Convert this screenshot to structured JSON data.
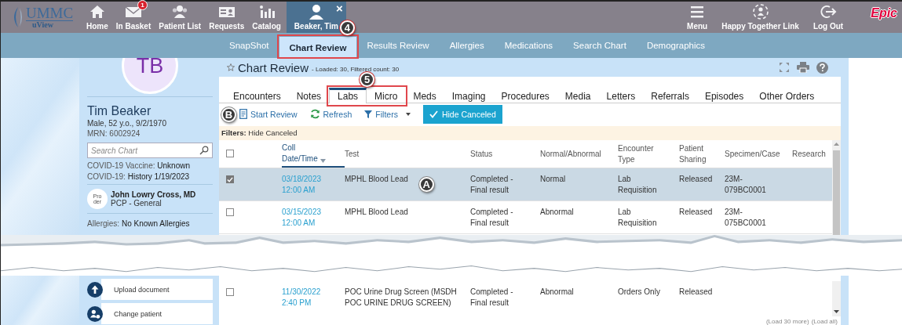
{
  "top_bar": {
    "logo": {
      "name": "UMMC",
      "sub": "uView"
    },
    "items": [
      {
        "label": "Home"
      },
      {
        "label": "In Basket",
        "badge": "1"
      },
      {
        "label": "Patient List"
      },
      {
        "label": "Requests"
      },
      {
        "label": "Catalog"
      }
    ],
    "patient_tab": {
      "label": "Beaker, Tim",
      "close": "×",
      "selected": true
    },
    "right_items": [
      {
        "label": "Menu"
      },
      {
        "label": "Happy Together Link"
      },
      {
        "label": "Log Out"
      }
    ],
    "brand": "Epic"
  },
  "nav_tabs": [
    {
      "label": "SnapShot",
      "selected": false
    },
    {
      "label": "Chart Review",
      "selected": true
    },
    {
      "label": "Results Review",
      "selected": false
    },
    {
      "label": "Allergies",
      "selected": false
    },
    {
      "label": "Medications",
      "selected": false
    },
    {
      "label": "Search Chart",
      "selected": false
    },
    {
      "label": "Demographics",
      "selected": false
    }
  ],
  "patient": {
    "initials": "TB",
    "name": "Tim Beaker",
    "details": "Male, 52 y.o., 9/2/1970",
    "mrn": "MRN: 6002924",
    "search_placeholder": "Search Chart",
    "facts": [
      "COVID-19 Vaccine: **Unknown**",
      "COVID-19: **History 1/19/2023**"
    ],
    "pcp": {
      "photo_alt_lines": [
        "Pro",
        "der"
      ],
      "name": "John Lowry Cross, MD",
      "role": "PCP - General"
    },
    "allergies": "Allergies: **No Known Allergies**",
    "actions": [
      {
        "label": "Upload document"
      },
      {
        "label": "Change patient"
      }
    ]
  },
  "chart_review": {
    "title": "Chart Review",
    "counts": "- Loaded: 30, Filtered count: 30",
    "tabs": [
      {
        "label": "Encounters",
        "selected": false
      },
      {
        "label": "Notes",
        "selected": false
      },
      {
        "label": "Labs",
        "selected": true
      },
      {
        "label": "Micro",
        "selected": false
      },
      {
        "label": "Meds",
        "selected": false
      },
      {
        "label": "Imaging",
        "selected": false
      },
      {
        "label": "Procedures",
        "selected": false
      },
      {
        "label": "Media",
        "selected": false
      },
      {
        "label": "Letters",
        "selected": false
      },
      {
        "label": "Referrals",
        "selected": false
      },
      {
        "label": "Episodes",
        "selected": false
      },
      {
        "label": "Other Orders",
        "selected": false
      }
    ],
    "toolbar": {
      "start_review": "Start Review",
      "refresh": "Refresh",
      "filters": "Filters",
      "hide_canceled": {
        "label": "Hide Canceled",
        "on": true
      }
    },
    "filter_summary": "**Filters:** Hide Canceled",
    "table": {
      "select_all_checked": false,
      "columns": [
        {
          "label": "Coll\nDate/Time",
          "sorted": true
        },
        {
          "label": "Test",
          "sorted": false
        },
        {
          "label": "Status",
          "sorted": false
        },
        {
          "label": "Normal/Abnormal",
          "sorted": false
        },
        {
          "label": "Encounter\nType",
          "sorted": false
        },
        {
          "label": "Patient\nSharing",
          "sorted": false
        },
        {
          "label": "Specimen/Case",
          "sorted": false
        },
        {
          "label": "Research",
          "sorted": false
        }
      ],
      "rows": [
        {
          "checked": true,
          "selected": true,
          "cells": [
            "03/18/2023\n12:00 AM",
            "MPHL Blood Lead",
            "Completed -\nFinal result",
            "Normal",
            "Lab\nRequisition",
            "Released",
            "23M-\n079BC0001",
            ""
          ]
        },
        {
          "checked": false,
          "selected": false,
          "cells": [
            "03/15/2023\n12:00 AM",
            "MPHL Blood Lead",
            "Completed -\nFinal result",
            "Abnormal",
            "Lab\nRequisition",
            "Released",
            "23M-\n075BC0001",
            ""
          ]
        }
      ],
      "rows_below_break": [
        {
          "checked": false,
          "selected": false,
          "cells": [
            "11/30/2022\n2:40 PM",
            "POC Urine Drug Screen (MSDH\nPOC URINE DRUG SCREEN)",
            "Completed -\nFinal result",
            "Abnormal",
            "Orders Only",
            "Released",
            "",
            ""
          ]
        }
      ],
      "load_links": [
        "(Load 30 more)",
        "(Load all)"
      ]
    }
  },
  "annotations": [
    {
      "label": "4",
      "box": true
    },
    {
      "label": "5",
      "box": true
    },
    {
      "label": "A",
      "box": false
    },
    {
      "label": "B",
      "box": false
    }
  ]
}
